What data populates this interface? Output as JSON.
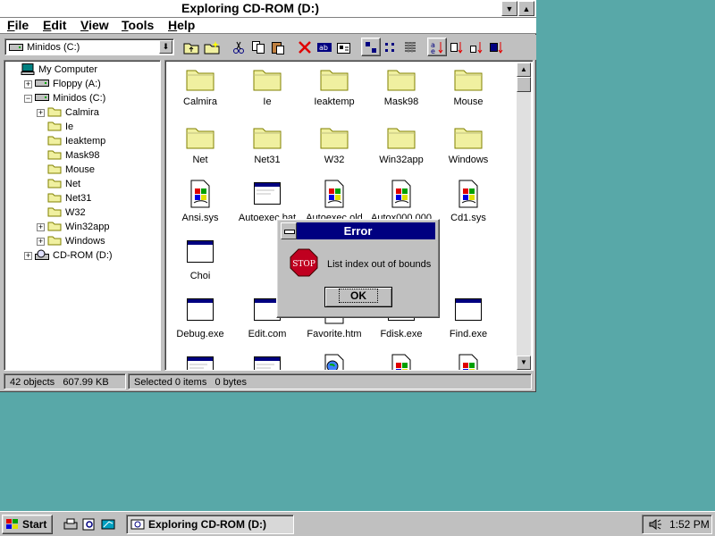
{
  "window": {
    "title": "Exploring CD-ROM (D:)"
  },
  "menu": [
    "File",
    "Edit",
    "View",
    "Tools",
    "Help"
  ],
  "toolbar": {
    "drive_selected": "Minidos (C:)",
    "tools": [
      "up-one-level",
      "map-network-drive",
      "cut",
      "copy",
      "paste",
      "delete",
      "rename",
      "properties",
      "large-icons",
      "small-icons",
      "list",
      "details",
      "sort-name",
      "sort-type",
      "sort-size",
      "sort-date"
    ]
  },
  "tree": [
    {
      "label": "My Computer",
      "icon": "computer-icon",
      "level": 0,
      "exp": ""
    },
    {
      "label": "Floppy (A:)",
      "icon": "floppy-drive-icon",
      "level": 1,
      "exp": "+"
    },
    {
      "label": "Minidos (C:)",
      "icon": "hard-drive-icon",
      "level": 1,
      "exp": "-"
    },
    {
      "label": "Calmira",
      "icon": "folder-icon",
      "level": 2,
      "exp": "+"
    },
    {
      "label": "Ie",
      "icon": "folder-icon",
      "level": 2,
      "exp": ""
    },
    {
      "label": "Ieaktemp",
      "icon": "folder-icon",
      "level": 2,
      "exp": ""
    },
    {
      "label": "Mask98",
      "icon": "folder-icon",
      "level": 2,
      "exp": ""
    },
    {
      "label": "Mouse",
      "icon": "folder-icon",
      "level": 2,
      "exp": ""
    },
    {
      "label": "Net",
      "icon": "folder-icon",
      "level": 2,
      "exp": ""
    },
    {
      "label": "Net31",
      "icon": "folder-icon",
      "level": 2,
      "exp": ""
    },
    {
      "label": "W32",
      "icon": "folder-icon",
      "level": 2,
      "exp": ""
    },
    {
      "label": "Win32app",
      "icon": "folder-icon",
      "level": 2,
      "exp": "+"
    },
    {
      "label": "Windows",
      "icon": "folder-icon",
      "level": 2,
      "exp": "+"
    },
    {
      "label": "CD-ROM (D:)",
      "icon": "cdrom-drive-icon",
      "level": 1,
      "exp": "+"
    }
  ],
  "files": [
    {
      "name": "Calmira",
      "icon": "folder-icon"
    },
    {
      "name": "Ie",
      "icon": "folder-icon"
    },
    {
      "name": "Ieaktemp",
      "icon": "folder-icon"
    },
    {
      "name": "Mask98",
      "icon": "folder-icon"
    },
    {
      "name": "Mouse",
      "icon": "folder-icon"
    },
    {
      "name": "Net",
      "icon": "folder-icon"
    },
    {
      "name": "Net31",
      "icon": "folder-icon"
    },
    {
      "name": "W32",
      "icon": "folder-icon"
    },
    {
      "name": "Win32app",
      "icon": "folder-icon"
    },
    {
      "name": "Windows",
      "icon": "folder-icon"
    },
    {
      "name": "Ansi.sys",
      "icon": "system-file-icon"
    },
    {
      "name": "Autoexec.bat",
      "icon": "batch-file-icon"
    },
    {
      "name": "Autoexec.old",
      "icon": "system-file-icon"
    },
    {
      "name": "Autox000.000",
      "icon": "system-file-icon"
    },
    {
      "name": "Cd1.sys",
      "icon": "system-file-icon"
    },
    {
      "name": "Choi",
      "icon": "program-icon"
    },
    {
      "name": "",
      "icon": ""
    },
    {
      "name": "",
      "icon": ""
    },
    {
      "name": "",
      "icon": ""
    },
    {
      "name": "",
      "icon": ""
    },
    {
      "name": "Debug.exe",
      "icon": "program-icon"
    },
    {
      "name": "Edit.com",
      "icon": "program-icon"
    },
    {
      "name": "Favorite.htm",
      "icon": "html-file-icon"
    },
    {
      "name": "Fdisk.exe",
      "icon": "program-icon"
    },
    {
      "name": "Find.exe",
      "icon": "program-icon"
    },
    {
      "name": "",
      "icon": "batch-file-icon"
    },
    {
      "name": "",
      "icon": "batch-file-icon"
    },
    {
      "name": "",
      "icon": "html-file-icon"
    },
    {
      "name": "",
      "icon": "system-file-icon"
    },
    {
      "name": "",
      "icon": "system-file-icon"
    }
  ],
  "status": {
    "objects": "42 objects",
    "size": "607.99 KB",
    "selected": "Selected 0 items   0 bytes"
  },
  "dialog": {
    "title": "Error",
    "message": "List index out of bounds",
    "ok_label": "OK",
    "icon_text": "STOP"
  },
  "taskbar": {
    "start_label": "Start",
    "task_label": "Exploring CD-ROM (D:)",
    "clock": "1:52 PM"
  },
  "colors": {
    "desktop": "#58a8a8",
    "dialog_title": "#000080",
    "folder": "#f0f0a0",
    "stop": "#c00020"
  }
}
